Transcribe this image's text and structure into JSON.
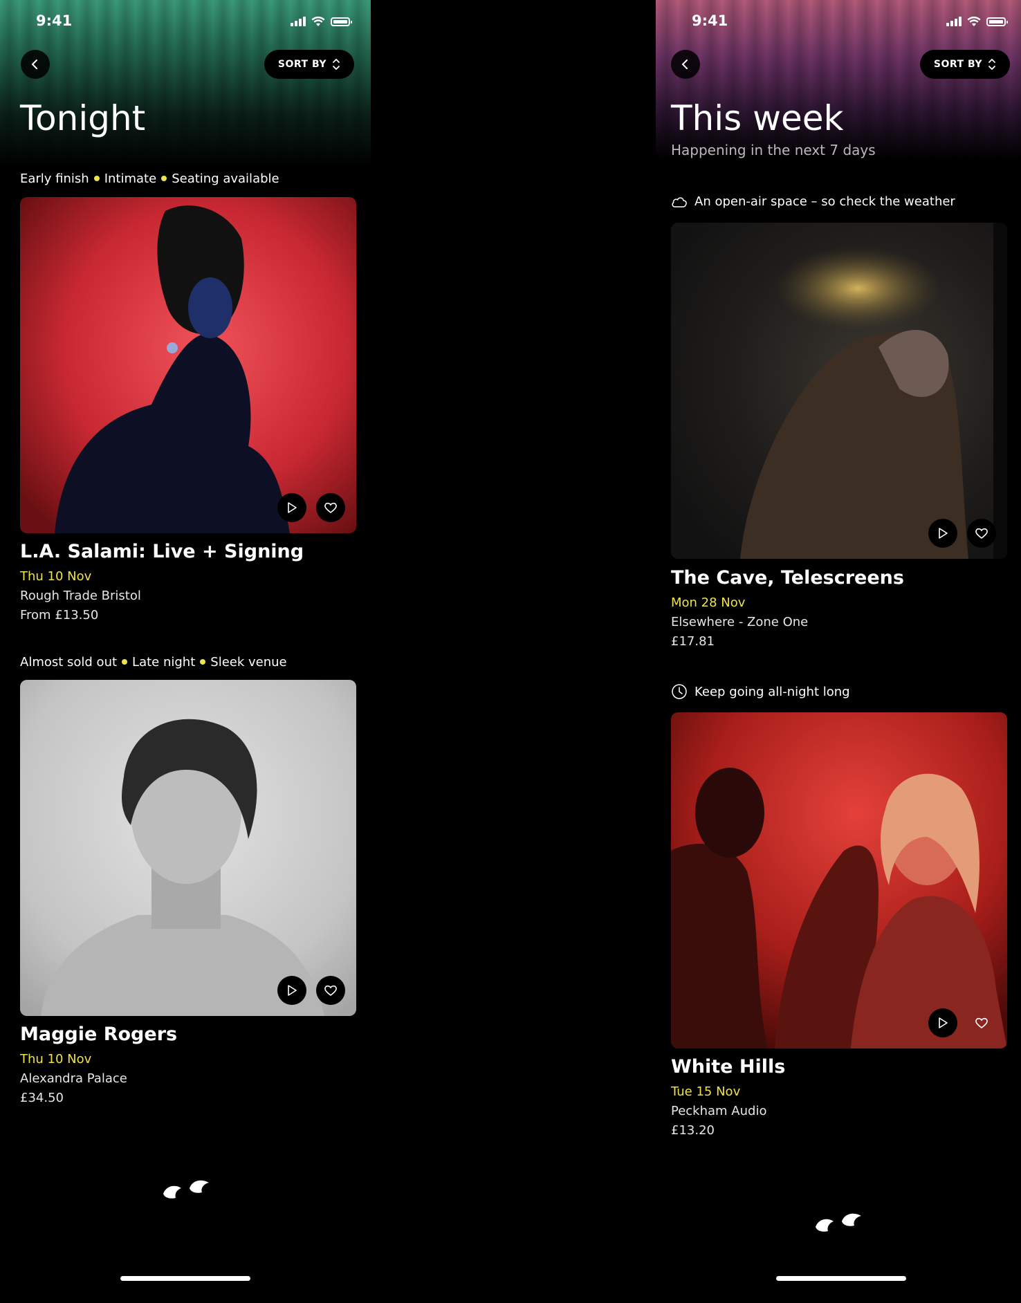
{
  "status_bar": {
    "time": "9:41"
  },
  "left_screen": {
    "sort_label": "SORT BY",
    "title": "Tonight",
    "events": [
      {
        "tags": [
          "Early finish",
          "Intimate",
          "Seating available"
        ],
        "name": "L.A. Salami: Live + Signing",
        "date": "Thu 10 Nov",
        "venue": "Rough Trade Bristol",
        "price": "From £13.50"
      },
      {
        "tags": [
          "Almost sold out",
          "Late night",
          "Sleek venue"
        ],
        "name": "Maggie Rogers",
        "date": "Thu 10 Nov",
        "venue": "Alexandra Palace",
        "price": "£34.50"
      }
    ]
  },
  "right_screen": {
    "sort_label": "SORT BY",
    "title": "This week",
    "subtitle": "Happening in the next 7 days",
    "events": [
      {
        "notice": "An open-air space – so check the weather",
        "notice_icon": "cloud-icon",
        "name": "The Cave, Telescreens",
        "date": "Mon 28 Nov",
        "venue": "Elsewhere - Zone One",
        "price": "£17.81"
      },
      {
        "notice": "Keep going all-night long",
        "notice_icon": "clock-icon",
        "name": "White Hills",
        "date": "Tue 15 Nov",
        "venue": "Peckham Audio",
        "price": "£13.20"
      }
    ]
  },
  "colors": {
    "accent_yellow": "#f1e24a",
    "background": "#000000",
    "text_secondary": "#b9b9b9"
  }
}
